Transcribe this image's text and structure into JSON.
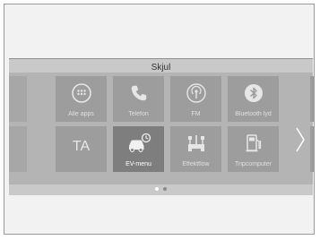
{
  "panel": {
    "hide_label": "Skjul"
  },
  "tiles": [
    {
      "label": "Alle apps",
      "icon": "apps-grid-icon"
    },
    {
      "label": "Telefon",
      "icon": "phone-icon"
    },
    {
      "label": "FM",
      "icon": "radio-fm-icon"
    },
    {
      "label": "Bluetooth lyd",
      "icon": "bluetooth-icon"
    },
    {
      "label": "",
      "big_text": "TA",
      "icon": "traffic-announcement-tile"
    },
    {
      "label": "EV-menu",
      "icon": "ev-car-clock-icon"
    },
    {
      "label": "Effektflow",
      "icon": "energy-flow-icon"
    },
    {
      "label": "Tripcomputer",
      "icon": "fuel-pump-icon"
    }
  ],
  "pager": {
    "pages": 2,
    "active_page": 1
  },
  "colors": {
    "tile": "#9d9d9d",
    "tile_highlight": "#7e7e7e",
    "tile_area": "#b4b4b4"
  }
}
